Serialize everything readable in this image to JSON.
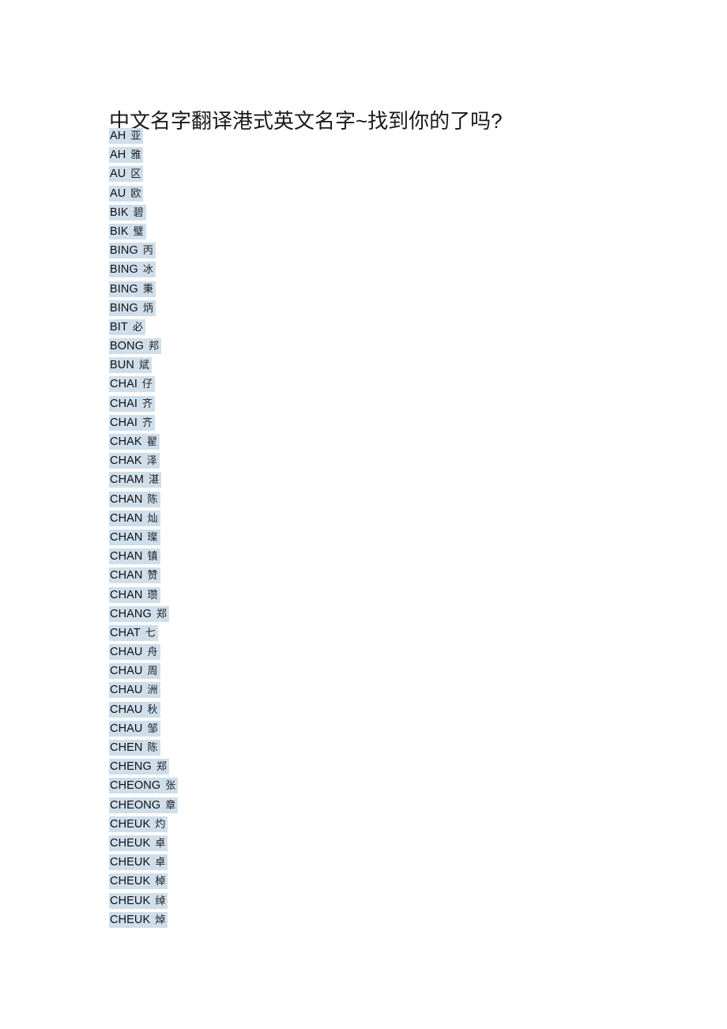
{
  "document": {
    "title": "中文名字翻译港式英文名字~找到你的了吗?",
    "highlight_color": "#cfdeeb",
    "text_color": "#111111",
    "background_color": "#ffffff"
  },
  "list": {
    "entries": [
      {
        "roman": "AH",
        "hanzi": "亚"
      },
      {
        "roman": "AH",
        "hanzi": "雅"
      },
      {
        "roman": "AU",
        "hanzi": "区"
      },
      {
        "roman": "AU",
        "hanzi": "欧"
      },
      {
        "roman": "BIK",
        "hanzi": "碧"
      },
      {
        "roman": "BIK",
        "hanzi": "璧"
      },
      {
        "roman": "BING",
        "hanzi": "丙"
      },
      {
        "roman": "BING",
        "hanzi": "冰"
      },
      {
        "roman": "BING",
        "hanzi": "秉"
      },
      {
        "roman": "BING",
        "hanzi": "炳"
      },
      {
        "roman": "BIT",
        "hanzi": "必"
      },
      {
        "roman": "BONG",
        "hanzi": "邦"
      },
      {
        "roman": "BUN",
        "hanzi": "斌"
      },
      {
        "roman": "CHAI",
        "hanzi": "仔"
      },
      {
        "roman": "CHAI",
        "hanzi": "齐"
      },
      {
        "roman": "CHAI",
        "hanzi": "齐"
      },
      {
        "roman": "CHAK",
        "hanzi": "翟"
      },
      {
        "roman": "CHAK",
        "hanzi": "泽"
      },
      {
        "roman": "CHAM",
        "hanzi": "湛"
      },
      {
        "roman": "CHAN",
        "hanzi": "陈"
      },
      {
        "roman": "CHAN",
        "hanzi": "灿"
      },
      {
        "roman": "CHAN",
        "hanzi": "璨"
      },
      {
        "roman": "CHAN",
        "hanzi": "镇"
      },
      {
        "roman": "CHAN",
        "hanzi": "赞"
      },
      {
        "roman": "CHAN",
        "hanzi": "瓒"
      },
      {
        "roman": "CHANG",
        "hanzi": "郑"
      },
      {
        "roman": "CHAT",
        "hanzi": "七"
      },
      {
        "roman": "CHAU",
        "hanzi": "舟"
      },
      {
        "roman": "CHAU",
        "hanzi": "周"
      },
      {
        "roman": "CHAU",
        "hanzi": "洲"
      },
      {
        "roman": "CHAU",
        "hanzi": "秋"
      },
      {
        "roman": "CHAU",
        "hanzi": "邹"
      },
      {
        "roman": "CHEN",
        "hanzi": "陈"
      },
      {
        "roman": "CHENG",
        "hanzi": "郑"
      },
      {
        "roman": "CHEONG",
        "hanzi": "张"
      },
      {
        "roman": "CHEONG",
        "hanzi": "章"
      },
      {
        "roman": "CHEUK",
        "hanzi": "灼"
      },
      {
        "roman": "CHEUK",
        "hanzi": "卓"
      },
      {
        "roman": "CHEUK",
        "hanzi": "卓"
      },
      {
        "roman": "CHEUK",
        "hanzi": "棹"
      },
      {
        "roman": "CHEUK",
        "hanzi": "绰"
      },
      {
        "roman": "CHEUK",
        "hanzi": "焯"
      }
    ]
  }
}
